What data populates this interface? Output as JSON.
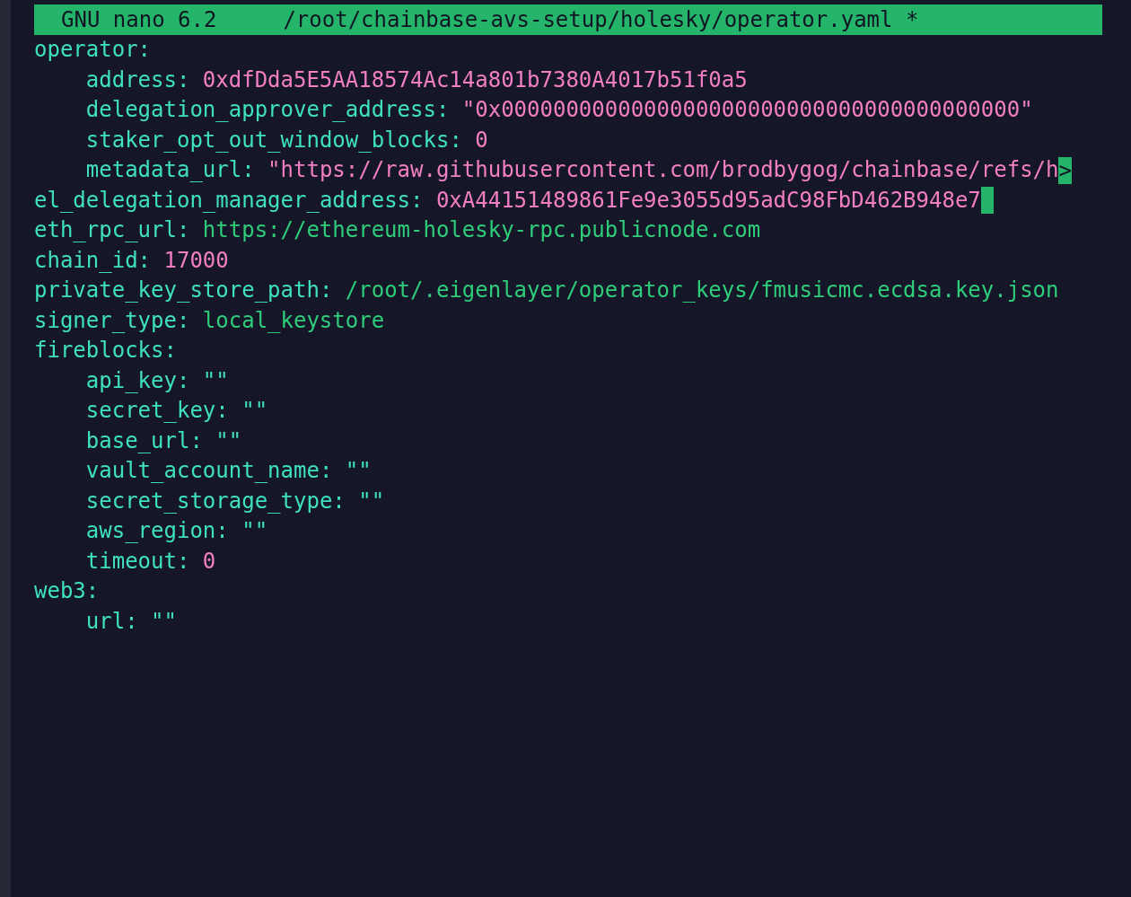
{
  "title_bar": {
    "program": "GNU nano 6.2",
    "file": "/root/chainbase-avs-setup/holesky/operator.yaml",
    "modified": "*"
  },
  "lines": [
    {
      "key": "operator:",
      "kind": "section",
      "cursor": false,
      "children": [
        {
          "key": "address:",
          "value": "0xdfDda5E5AA18574Ac14a801b7380A4017b51f0a5",
          "kind": "literal",
          "cursor": false
        },
        {
          "key": "delegation_approver_address:",
          "value": "\"0x0000000000000000000000000000000000000000\"",
          "kind": "literal",
          "cursor": false
        },
        {
          "key": "staker_opt_out_window_blocks:",
          "value": "0",
          "kind": "literal",
          "cursor": false
        },
        {
          "key": "metadata_url:",
          "value": "\"https://raw.githubusercontent.com/brodbygog/chainbase/refs/h",
          "kind": "literal",
          "overflow_marker": ">",
          "cursor": false
        }
      ]
    },
    {
      "key": "el_delegation_manager_address:",
      "value": "0xA44151489861Fe9e3055d95adC98FbD462B948e7",
      "kind": "literal",
      "cursor": true
    },
    {
      "key": "eth_rpc_url:",
      "value": "https://ethereum-holesky-rpc.publicnode.com",
      "kind": "plain",
      "cursor": false
    },
    {
      "key": "chain_id:",
      "value": "17000",
      "kind": "literal",
      "cursor": false
    },
    {
      "key": "private_key_store_path:",
      "value": "/root/.eigenlayer/operator_keys/fmusicmc.ecdsa.key.json",
      "kind": "plain",
      "cursor": false
    },
    {
      "key": "signer_type:",
      "value": "local_keystore",
      "kind": "plain",
      "cursor": false
    },
    {
      "key": "fireblocks:",
      "kind": "section",
      "cursor": false,
      "children": [
        {
          "key": "api_key:",
          "value": "\"\"",
          "kind": "empty",
          "cursor": false
        },
        {
          "key": "secret_key:",
          "value": "\"\"",
          "kind": "empty",
          "cursor": false
        },
        {
          "key": "base_url:",
          "value": "\"\"",
          "kind": "empty",
          "cursor": false
        },
        {
          "key": "vault_account_name:",
          "value": "\"\"",
          "kind": "empty",
          "cursor": false
        },
        {
          "key": "secret_storage_type:",
          "value": "\"\"",
          "kind": "empty",
          "cursor": false
        },
        {
          "key": "aws_region:",
          "value": "\"\"",
          "kind": "empty",
          "cursor": false
        },
        {
          "key": "timeout:",
          "value": "0",
          "kind": "literal",
          "cursor": false
        }
      ]
    },
    {
      "key": "web3:",
      "kind": "section",
      "cursor": false,
      "children": [
        {
          "key": "url:",
          "value": "\"\"",
          "kind": "empty",
          "cursor": false
        }
      ]
    }
  ]
}
